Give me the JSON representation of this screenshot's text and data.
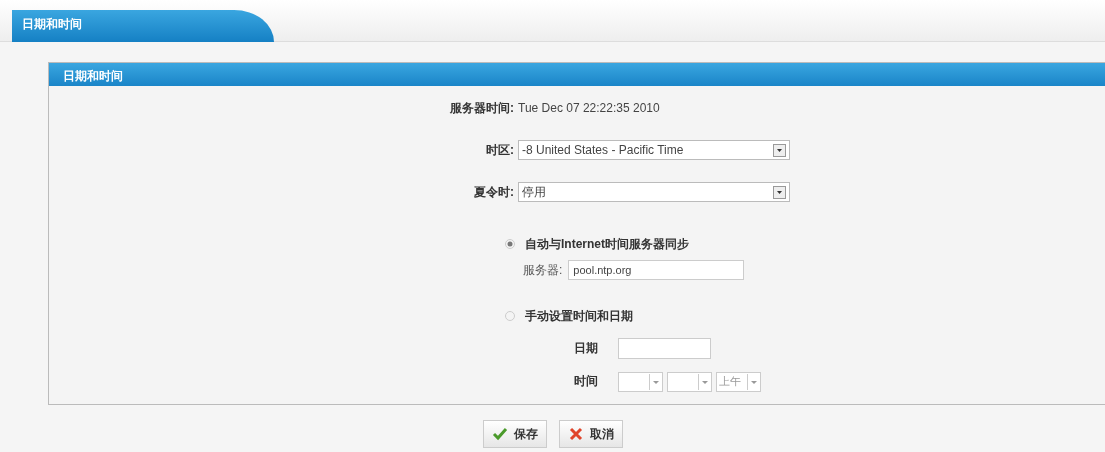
{
  "tab": {
    "label": "日期和时间",
    "selected": true
  },
  "panel": {
    "title": "日期和时间"
  },
  "server_time": {
    "label": "服务器时间:",
    "value": "Tue Dec 07 22:22:35 2010"
  },
  "timezone": {
    "label": "时区:",
    "value": "-8 United States - Pacific Time"
  },
  "dst": {
    "label": "夏令时:",
    "value": "停用"
  },
  "sync_options": [
    {
      "label": "自动与Internet时间服务器同步",
      "selected": true
    },
    {
      "label": "手动设置时间和日期",
      "selected": false
    }
  ],
  "ntp": {
    "label": "服务器:",
    "value": "pool.ntp.org"
  },
  "manual": {
    "date_label": "日期",
    "time_label": "时间",
    "ampm": "上午"
  },
  "buttons": [
    {
      "kind": "save",
      "label": "保存"
    },
    {
      "kind": "cancel",
      "label": "取消"
    }
  ]
}
